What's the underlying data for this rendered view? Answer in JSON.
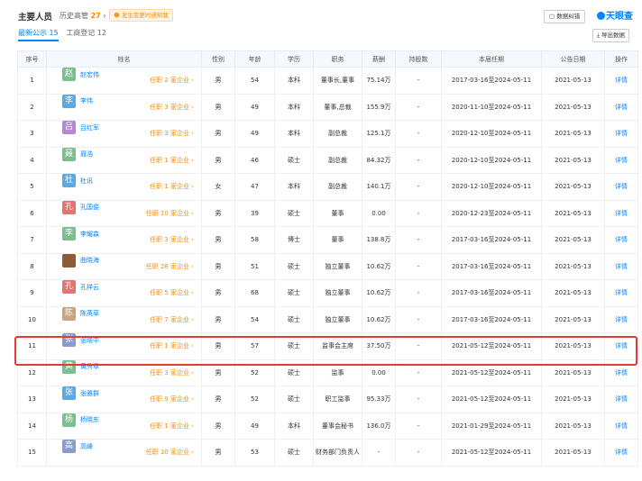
{
  "header": {
    "title": "主要人员",
    "history_label": "历史高管",
    "history_count": "27",
    "notice": "☻ 发生变更时通知我",
    "tab_latest": "最新公示 15",
    "tab_registration": "工商登记 12",
    "feedback_label": "数据纠错",
    "logo_text": "天眼查",
    "export_label": "导出数据"
  },
  "columns": [
    "序号",
    "姓名",
    "性别",
    "年龄",
    "学历",
    "职务",
    "薪酬",
    "持股数",
    "本届任期",
    "公告日期",
    "操作"
  ],
  "rows": [
    {
      "no": "1",
      "avatar": "赵",
      "avatar_color": "#7cbf8e",
      "name": "赵宏伟",
      "roles": "任职 2 家企业 ›",
      "gender": "男",
      "age": "54",
      "edu": "本科",
      "position": "董事长,董事",
      "salary": "75.14万",
      "shares": "-",
      "term": "2017-03-16至2024-05-11",
      "date": "2021-05-13",
      "action": "详情"
    },
    {
      "no": "2",
      "avatar": "李",
      "avatar_color": "#5aa9e6",
      "name": "李伟",
      "roles": "任职 3 家企业 ›",
      "gender": "男",
      "age": "49",
      "edu": "本科",
      "position": "董事,总裁",
      "salary": "155.9万",
      "shares": "-",
      "term": "2020-11-10至2024-05-11",
      "date": "2021-05-13",
      "action": "详情"
    },
    {
      "no": "3",
      "avatar": "吕",
      "avatar_color": "#b18ad6",
      "name": "吕红军",
      "roles": "任职 3 家企业 ›",
      "gender": "男",
      "age": "49",
      "edu": "本科",
      "position": "副总裁",
      "salary": "125.1万",
      "shares": "-",
      "term": "2020-12-10至2024-05-11",
      "date": "2021-05-13",
      "action": "详情"
    },
    {
      "no": "4",
      "avatar": "聂",
      "avatar_color": "#7cbf8e",
      "name": "聂浩",
      "roles": "任职 1 家企业 ›",
      "gender": "男",
      "age": "46",
      "edu": "硕士",
      "position": "副总裁",
      "salary": "84.32万",
      "shares": "-",
      "term": "2020-12-10至2024-05-11",
      "date": "2021-05-13",
      "action": "详情"
    },
    {
      "no": "5",
      "avatar": "杜",
      "avatar_color": "#5aa9e6",
      "name": "杜讯",
      "roles": "任职 1 家企业 ›",
      "gender": "女",
      "age": "47",
      "edu": "本科",
      "position": "副总裁",
      "salary": "140.1万",
      "shares": "-",
      "term": "2020-12-10至2024-05-11",
      "date": "2021-05-13",
      "action": "详情"
    },
    {
      "no": "6",
      "avatar": "孔",
      "avatar_color": "#e57373",
      "name": "孔国俊",
      "roles": "任职 10 家企业 ›",
      "gender": "男",
      "age": "39",
      "edu": "硕士",
      "position": "董事",
      "salary": "0.00",
      "shares": "-",
      "term": "2020-12-23至2024-05-11",
      "date": "2021-05-13",
      "action": "详情"
    },
    {
      "no": "7",
      "avatar": "李",
      "avatar_color": "#7cbf8e",
      "name": "李耀森",
      "roles": "任职 3 家企业 ›",
      "gender": "男",
      "age": "58",
      "edu": "博士",
      "position": "董事",
      "salary": "138.8万",
      "shares": "-",
      "term": "2017-03-16至2024-05-11",
      "date": "2021-05-13",
      "action": "详情"
    },
    {
      "no": "8",
      "avatar": "",
      "avatar_color": "#8d5a3a",
      "name": "曲晓海",
      "roles": "任职 28 家企业 ›",
      "gender": "男",
      "age": "51",
      "edu": "硕士",
      "position": "独立董事",
      "salary": "10.62万",
      "shares": "-",
      "term": "2017-03-16至2024-05-11",
      "date": "2021-05-13",
      "action": "详情"
    },
    {
      "no": "9",
      "avatar": "孔",
      "avatar_color": "#e57373",
      "name": "孔祥云",
      "roles": "任职 5 家企业 ›",
      "gender": "男",
      "age": "68",
      "edu": "硕士",
      "position": "独立董事",
      "salary": "10.62万",
      "shares": "-",
      "term": "2017-03-16至2024-05-11",
      "date": "2021-05-13",
      "action": "详情"
    },
    {
      "no": "10",
      "avatar": "陈",
      "avatar_color": "#c9a27e",
      "name": "陈英草",
      "roles": "任职 7 家企业 ›",
      "gender": "男",
      "age": "54",
      "edu": "硕士",
      "position": "独立董事",
      "salary": "10.62万",
      "shares": "-",
      "term": "2017-03-16至2024-05-11",
      "date": "2021-05-13",
      "action": "详情"
    },
    {
      "no": "11",
      "avatar": "张",
      "avatar_color": "#8a9bd0",
      "name": "张晓中",
      "roles": "任职 1 家企业 ›",
      "gender": "男",
      "age": "57",
      "edu": "硕士",
      "position": "监事会主席",
      "salary": "37.50万",
      "shares": "-",
      "term": "2021-05-12至2024-05-11",
      "date": "2021-05-13",
      "action": "详情"
    },
    {
      "no": "12",
      "avatar": "黄",
      "avatar_color": "#7cbf8e",
      "name": "黄秀章",
      "roles": "任职 3 家企业 ›",
      "gender": "男",
      "age": "52",
      "edu": "硕士",
      "position": "监事",
      "salary": "0.00",
      "shares": "-",
      "term": "2021-05-12至2024-05-11",
      "date": "2021-05-13",
      "action": "详情"
    },
    {
      "no": "13",
      "avatar": "张",
      "avatar_color": "#5aa9e6",
      "name": "张雅群",
      "roles": "任职 9 家企业 ›",
      "gender": "男",
      "age": "52",
      "edu": "硕士",
      "position": "职工监事",
      "salary": "95.33万",
      "shares": "-",
      "term": "2021-05-12至2024-05-11",
      "date": "2021-05-13",
      "action": "详情"
    },
    {
      "no": "14",
      "avatar": "杨",
      "avatar_color": "#7cbf8e",
      "name": "杨晓东",
      "roles": "任职 1 家企业 ›",
      "gender": "男",
      "age": "49",
      "edu": "本科",
      "position": "董事会秘书",
      "salary": "136.0万",
      "shares": "-",
      "term": "2021-01-29至2024-05-11",
      "date": "2021-05-13",
      "action": "详情"
    },
    {
      "no": "15",
      "avatar": "高",
      "avatar_color": "#8a9bd0",
      "name": "高峰",
      "roles": "任职 10 家企业 ›",
      "gender": "男",
      "age": "53",
      "edu": "硕士",
      "position": "财务部门负责人",
      "salary": "-",
      "shares": "-",
      "term": "2021-05-12至2024-05-11",
      "date": "2021-05-13",
      "action": "详情"
    }
  ]
}
